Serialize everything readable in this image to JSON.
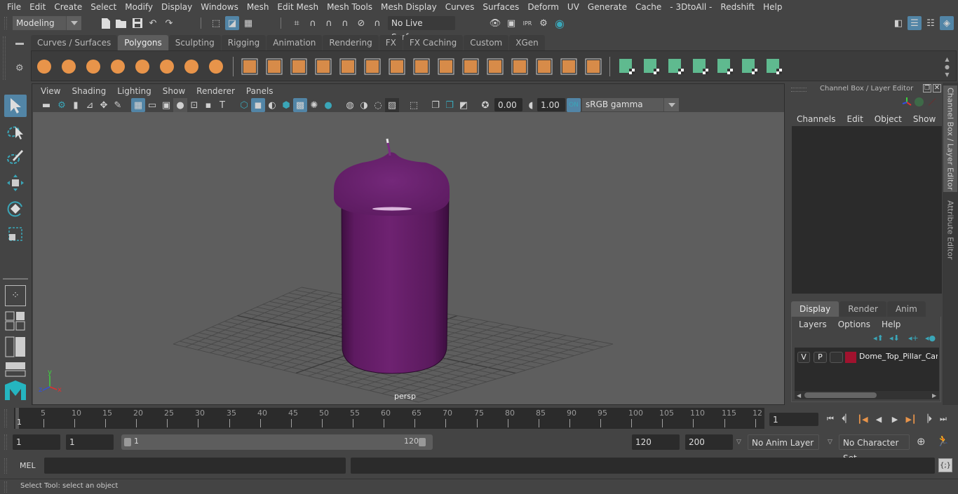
{
  "menubar": {
    "items": [
      "File",
      "Edit",
      "Create",
      "Select",
      "Modify",
      "Display",
      "Windows",
      "Mesh",
      "Edit Mesh",
      "Mesh Tools",
      "Mesh Display",
      "Curves",
      "Surfaces",
      "Deform",
      "UV",
      "Generate",
      "Cache",
      "- 3DtoAll -",
      "Redshift",
      "Help"
    ]
  },
  "statusline": {
    "mode": "Modeling",
    "live_surface": "No Live Surface",
    "icons": [
      "new-scene-icon",
      "open-scene-icon",
      "save-scene-icon",
      "undo-icon",
      "redo-icon",
      "select-by-hierarchy-icon",
      "select-by-object-icon",
      "select-by-component-icon",
      "snap-grid-icon",
      "snap-curve-icon",
      "snap-point-icon",
      "snap-view-plane-icon",
      "snap-live-icon",
      "make-live-icon",
      "render-view-icon",
      "render-current-frame-icon",
      "ipr-render-icon",
      "render-settings-icon",
      "hypershade-icon"
    ],
    "right_icons": [
      "modeling-toolkit-icon",
      "attribute-editor-toggle-icon",
      "tool-settings-toggle-icon",
      "channel-box-toggle-icon"
    ]
  },
  "shelf": {
    "tabs": [
      "Curves / Surfaces",
      "Polygons",
      "Sculpting",
      "Rigging",
      "Animation",
      "Rendering",
      "FX",
      "FX Caching",
      "Custom",
      "XGen"
    ],
    "active_tab": "Polygons",
    "tools": [
      "poly-sphere",
      "poly-cube",
      "poly-cylinder",
      "poly-cone",
      "poly-plane",
      "poly-torus",
      "poly-pyramid",
      "poly-pipe",
      "combine",
      "separate",
      "mirror",
      "smooth",
      "extract",
      "bevel",
      "bridge",
      "multi-cut",
      "extrude",
      "append",
      "insert-edge-loop",
      "target-weld",
      "bridge-edge",
      "quad-draw",
      "poly-count",
      "planar-uv",
      "cylindrical-uv",
      "spherical-uv",
      "automatic-uv",
      "contour-uv",
      "uv-editor",
      "unfold-uv"
    ],
    "accent_orange": "#e8944a",
    "accent_green": "#5fba8f"
  },
  "toolbox": {
    "tools": [
      "select-tool",
      "lasso-tool",
      "paint-select-tool",
      "move-tool",
      "rotate-tool",
      "scale-tool"
    ],
    "layouts": [
      "single-perspective-layout",
      "four-view-layout",
      "outliner-perspective-layout",
      "persp-graph-layout"
    ]
  },
  "viewport": {
    "menu": [
      "View",
      "Shading",
      "Lighting",
      "Show",
      "Renderer",
      "Panels"
    ],
    "exposure": "0.00",
    "gamma": "1.00",
    "color_space": "sRGB gamma",
    "camera_label": "persp",
    "object_color": "#6b1f6e",
    "axis_labels": {
      "x": "x",
      "y": "y",
      "z": "z"
    }
  },
  "channel_box": {
    "title": "Channel Box / Layer Editor",
    "menu": [
      "Channels",
      "Edit",
      "Object",
      "Show"
    ]
  },
  "layer_editor": {
    "tabs": [
      "Display",
      "Render",
      "Anim"
    ],
    "active_tab": "Display",
    "menu": [
      "Layers",
      "Options",
      "Help"
    ],
    "layers": [
      {
        "v": "V",
        "p": "P",
        "color": "#a0122e",
        "name": "Dome_Top_Pillar_Canc"
      }
    ]
  },
  "side_tabs": [
    "Channel Box / Layer Editor",
    "Attribute Editor"
  ],
  "timeline": {
    "ticks": [
      5,
      10,
      15,
      20,
      25,
      30,
      35,
      40,
      45,
      50,
      55,
      60,
      65,
      70,
      75,
      80,
      85,
      90,
      95,
      100,
      105,
      110,
      115,
      "12"
    ],
    "current_frame_marker": "1",
    "current_frame": "1"
  },
  "range": {
    "start": "1",
    "playback_start": "1",
    "slider_start": "1",
    "slider_end": "120",
    "playback_end": "120",
    "end": "200",
    "anim_layer": "No Anim Layer",
    "character_set": "No Character Set"
  },
  "command": {
    "lang": "MEL",
    "input": "",
    "output": ""
  },
  "help_line": "Select Tool: select an object"
}
